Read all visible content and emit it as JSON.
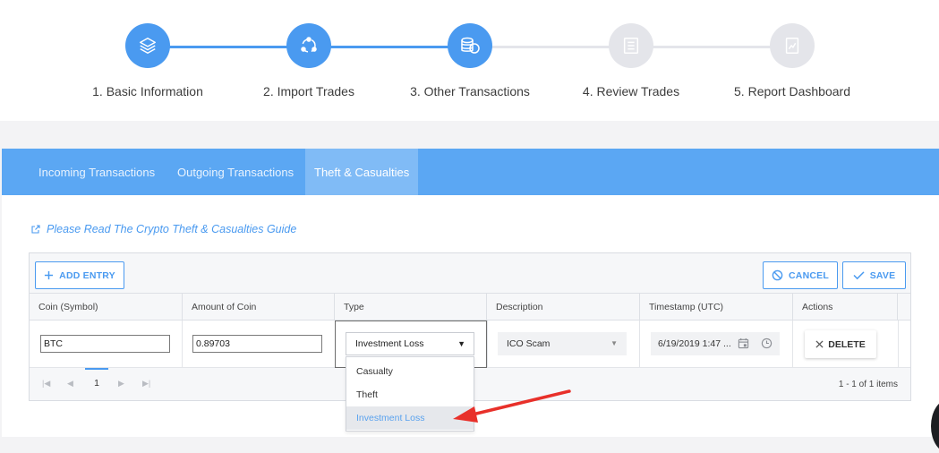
{
  "steps": [
    {
      "number_label": "1. Basic Information",
      "icon": "layers-icon",
      "state": "complete"
    },
    {
      "number_label": "2. Import Trades",
      "icon": "share-nodes-icon",
      "state": "complete"
    },
    {
      "number_label": "3. Other Transactions",
      "icon": "coins-stack-icon",
      "state": "current"
    },
    {
      "number_label": "4. Review Trades",
      "icon": "list-icon",
      "state": "pending"
    },
    {
      "number_label": "5. Report Dashboard",
      "icon": "chart-report-icon",
      "state": "pending"
    }
  ],
  "tabs": [
    {
      "label": "Incoming Transactions",
      "active": false
    },
    {
      "label": "Outgoing Transactions",
      "active": false
    },
    {
      "label": "Theft & Casualties",
      "active": true
    }
  ],
  "guide_link": {
    "icon": "external-link-icon",
    "text": "Please Read The Crypto Theft & Casualties Guide"
  },
  "toolbar": {
    "add_label": "ADD ENTRY",
    "cancel_label": "CANCEL",
    "save_label": "SAVE"
  },
  "columns": [
    "Coin (Symbol)",
    "Amount of Coin",
    "Type",
    "Description",
    "Timestamp (UTC)",
    "Actions"
  ],
  "row": {
    "coin": "BTC",
    "amount": "0.89703",
    "type": "Investment Loss",
    "description": "ICO Scam",
    "timestamp": "6/19/2019 1:47 ...",
    "delete_label": "DELETE"
  },
  "pager": {
    "current_page": "1",
    "summary": "1 - 1 of 1 items"
  },
  "type_options": [
    "Casualty",
    "Theft",
    "Investment Loss"
  ],
  "selected_option": "Investment Loss",
  "colors": {
    "accent": "#4a9af0",
    "tab_bar": "#5ba7f3",
    "arrow": "#e8302a"
  }
}
